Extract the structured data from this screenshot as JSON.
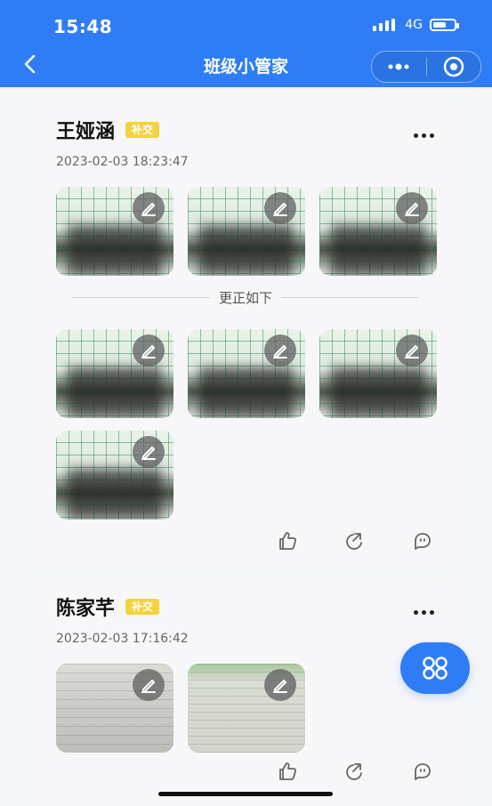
{
  "status": {
    "time": "15:48",
    "network": "4G"
  },
  "nav": {
    "title": "班级小管家"
  },
  "entries": [
    {
      "name": "王娅涵",
      "badge": "补交",
      "timestamp": "2023-02-03 18:23:47",
      "separator_text": "更正如下",
      "thumbnails_top": [
        "image",
        "image",
        "image"
      ],
      "thumbnails_bottom": [
        "image",
        "image",
        "image",
        "image"
      ]
    },
    {
      "name": "陈家芊",
      "badge": "补交",
      "timestamp": "2023-02-03 17:16:42",
      "thumbnails": [
        "image",
        "image"
      ]
    }
  ],
  "icons": {
    "back": "chevron-left-icon",
    "more": "more-icon",
    "target": "target-icon",
    "edit": "edit-icon",
    "like": "thumbs-up-icon",
    "share": "share-icon",
    "comment": "comment-icon",
    "menu": "grid-menu-icon"
  },
  "colors": {
    "primary": "#2f7df6",
    "badge": "#f4d23c"
  }
}
